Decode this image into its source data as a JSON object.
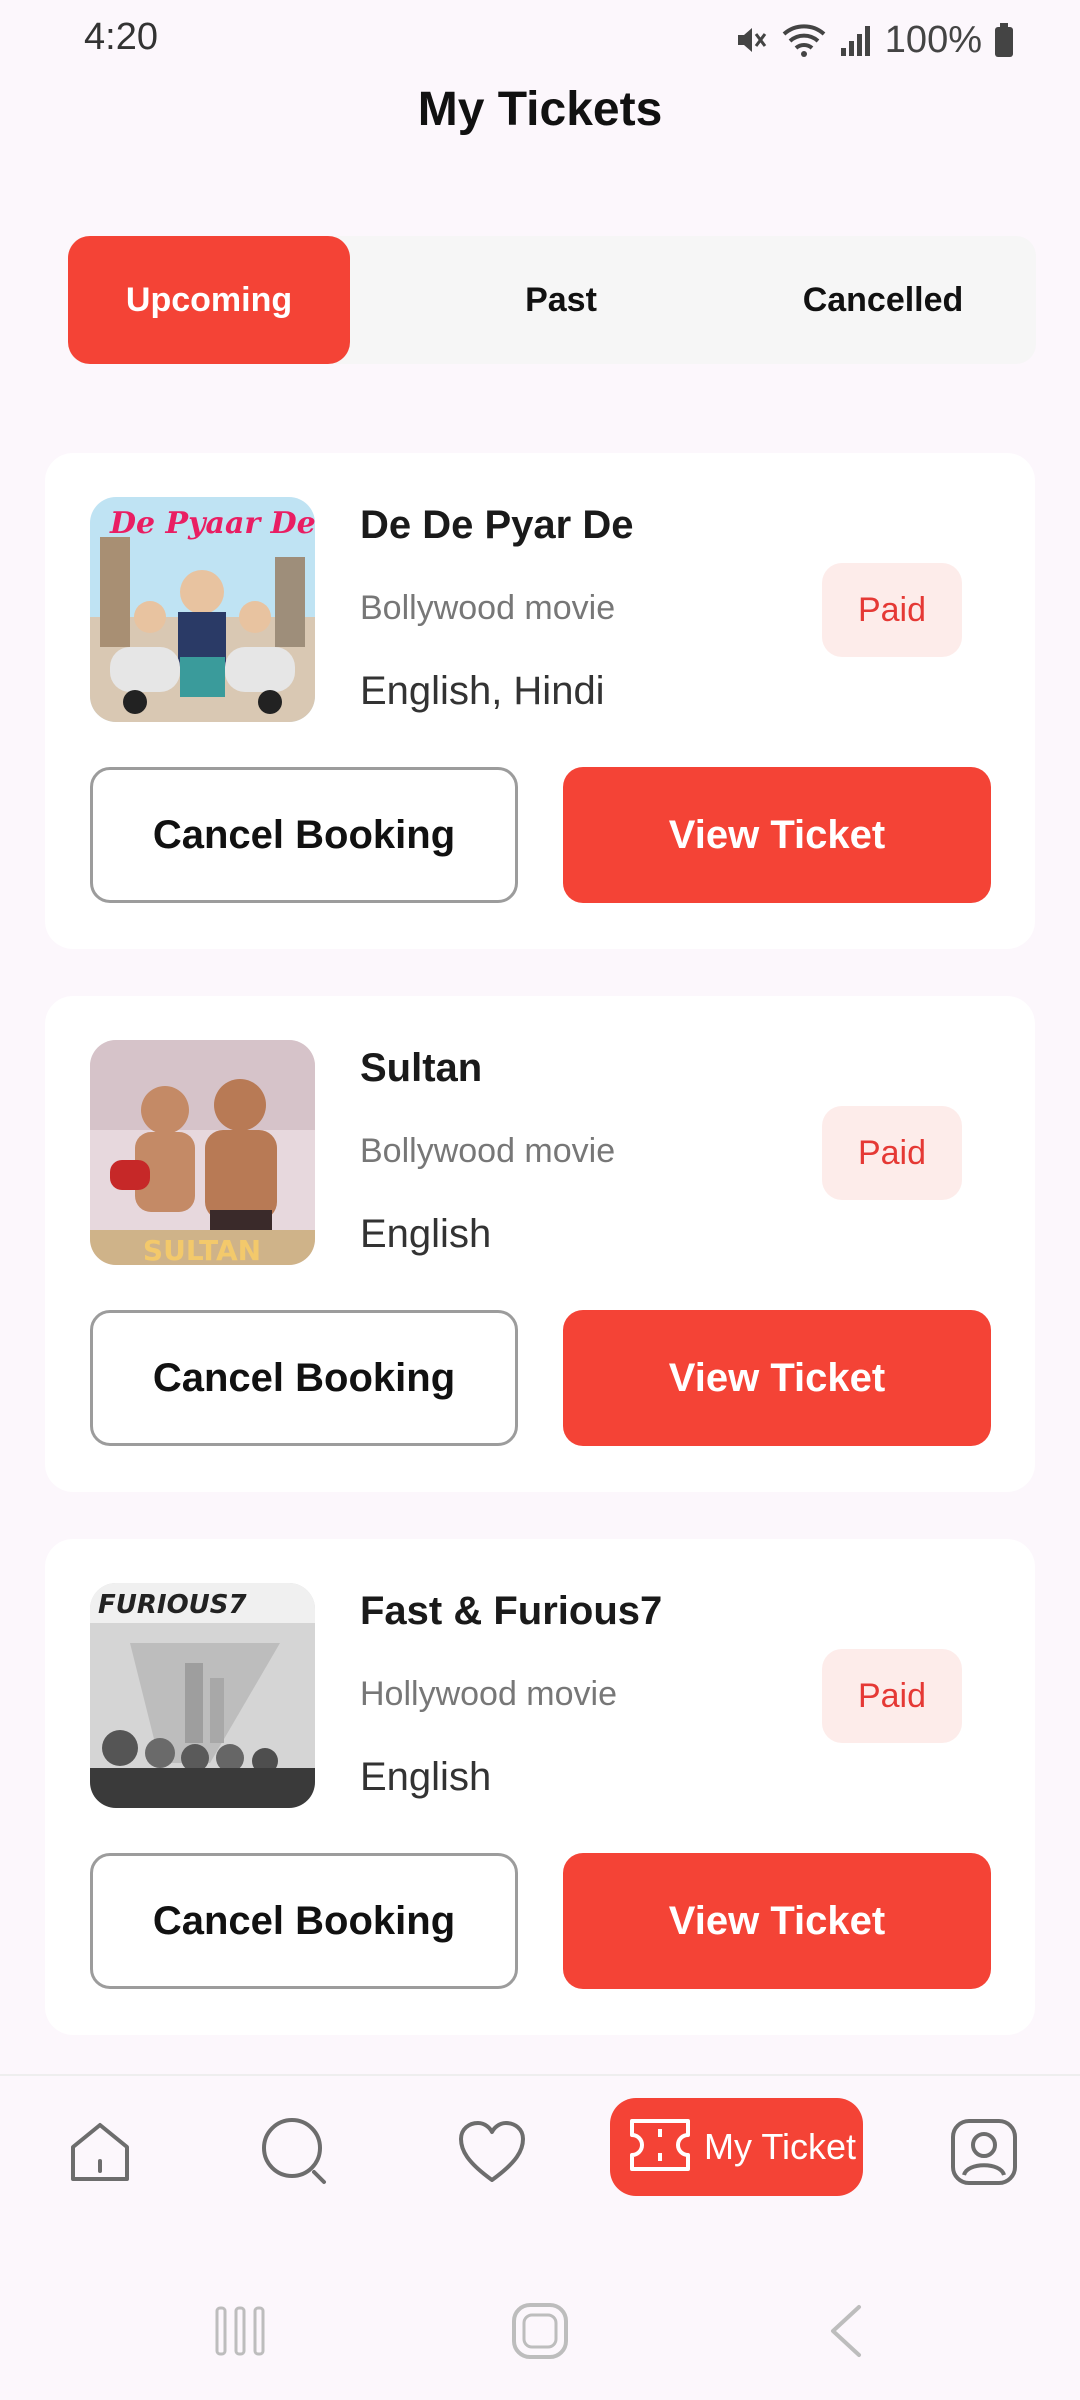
{
  "status_bar": {
    "time": "4:20",
    "battery": "100%",
    "icons": [
      "mute-icon",
      "wifi-icon",
      "signal-icon",
      "battery-icon"
    ]
  },
  "header": {
    "title": "My Tickets"
  },
  "tabs": [
    {
      "label": "Upcoming",
      "active": true
    },
    {
      "label": "Past",
      "active": false
    },
    {
      "label": "Cancelled",
      "active": false
    }
  ],
  "tickets": [
    {
      "title": "De De Pyar De",
      "genre": "Bollywood movie",
      "languages": "English, Hindi",
      "status": "Paid",
      "cancel_label": "Cancel Booking",
      "view_label": "View Ticket",
      "poster_text": "De Pyaar De"
    },
    {
      "title": "Sultan",
      "genre": "Bollywood movie",
      "languages": "English",
      "status": "Paid",
      "cancel_label": "Cancel Booking",
      "view_label": "View Ticket",
      "poster_text": "SULTAN"
    },
    {
      "title": "Fast & Furious7",
      "genre": "Hollywood movie",
      "languages": "English",
      "status": "Paid",
      "cancel_label": "Cancel Booking",
      "view_label": "View Ticket",
      "poster_text": "FURIOUS7"
    }
  ],
  "bottom_nav": {
    "items": [
      "home-icon",
      "search-icon",
      "heart-icon",
      "ticket-icon",
      "profile-icon"
    ],
    "active_label": "My Ticket"
  },
  "colors": {
    "accent": "#f44336",
    "badge_bg": "#fdecea",
    "background": "#fcf7fc"
  }
}
